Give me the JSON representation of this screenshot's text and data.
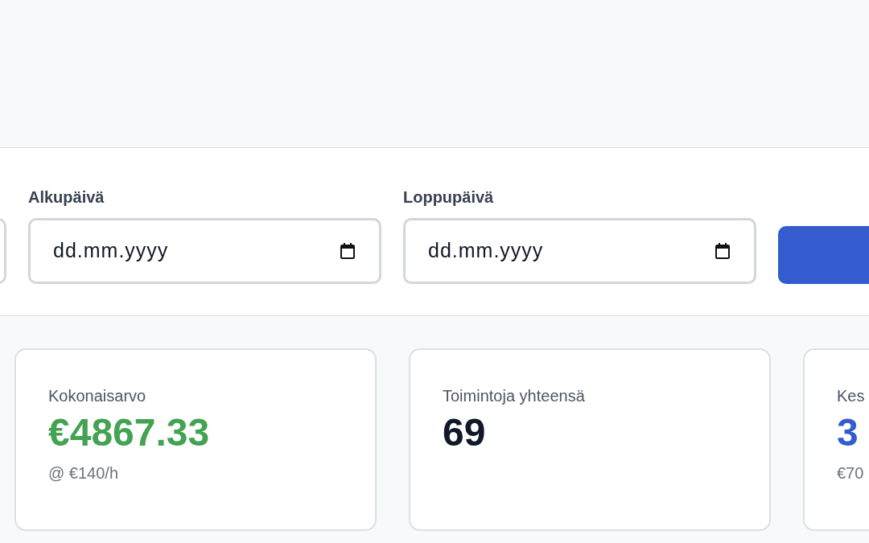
{
  "filters": {
    "fields": [
      {
        "label": "Alkupäivä",
        "placeholder": "dd.mm.yyyy"
      },
      {
        "label": "Loppupäivä",
        "placeholder": "dd.mm.yyyy"
      }
    ]
  },
  "stats": [
    {
      "label": "Kokonaisarvo",
      "value": "€4867.33",
      "note": "@ €140/h",
      "color": "#43a352"
    },
    {
      "label": "Toimintoja yhteensä",
      "value": "69",
      "color": "#111827"
    },
    {
      "label": "Kes",
      "value": "3",
      "note": "€70",
      "color": "#345ccf"
    }
  ]
}
